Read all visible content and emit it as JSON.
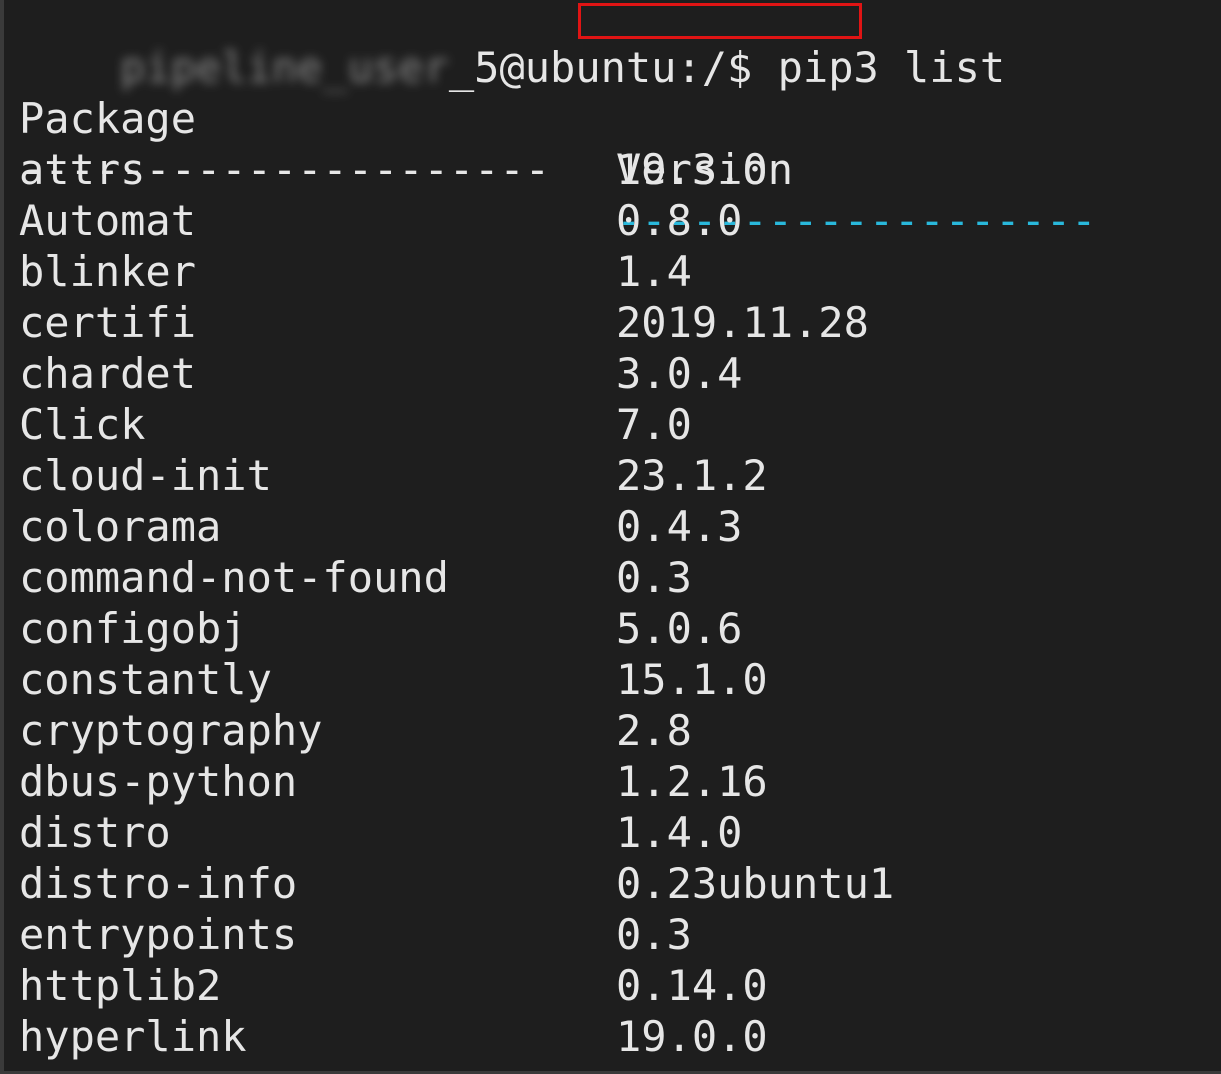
{
  "terminal": {
    "prompt": {
      "user_redacted": "pipeline_user",
      "suffix": "_5@ubuntu:/$",
      "command": "pip3 list"
    },
    "header": {
      "package": "Package",
      "version": "Version"
    },
    "separator": {
      "package": "---------------------",
      "version": "-------------------"
    },
    "rows": [
      {
        "package": "attrs",
        "version": "19.3.0"
      },
      {
        "package": "Automat",
        "version": "0.8.0"
      },
      {
        "package": "blinker",
        "version": "1.4"
      },
      {
        "package": "certifi",
        "version": "2019.11.28"
      },
      {
        "package": "chardet",
        "version": "3.0.4"
      },
      {
        "package": "Click",
        "version": "7.0"
      },
      {
        "package": "cloud-init",
        "version": "23.1.2"
      },
      {
        "package": "colorama",
        "version": "0.4.3"
      },
      {
        "package": "command-not-found",
        "version": "0.3"
      },
      {
        "package": "configobj",
        "version": "5.0.6"
      },
      {
        "package": "constantly",
        "version": "15.1.0"
      },
      {
        "package": "cryptography",
        "version": "2.8"
      },
      {
        "package": "dbus-python",
        "version": "1.2.16"
      },
      {
        "package": "distro",
        "version": "1.4.0"
      },
      {
        "package": "distro-info",
        "version": "0.23ubuntu1"
      },
      {
        "package": "entrypoints",
        "version": "0.3"
      },
      {
        "package": "httplib2",
        "version": "0.14.0"
      },
      {
        "package": "hyperlink",
        "version": "19.0.0"
      }
    ],
    "colors": {
      "background": "#1e1e1e",
      "text": "#e6e6e6",
      "version_separator": "#29b8db",
      "highlight_box": "#e01414"
    }
  }
}
